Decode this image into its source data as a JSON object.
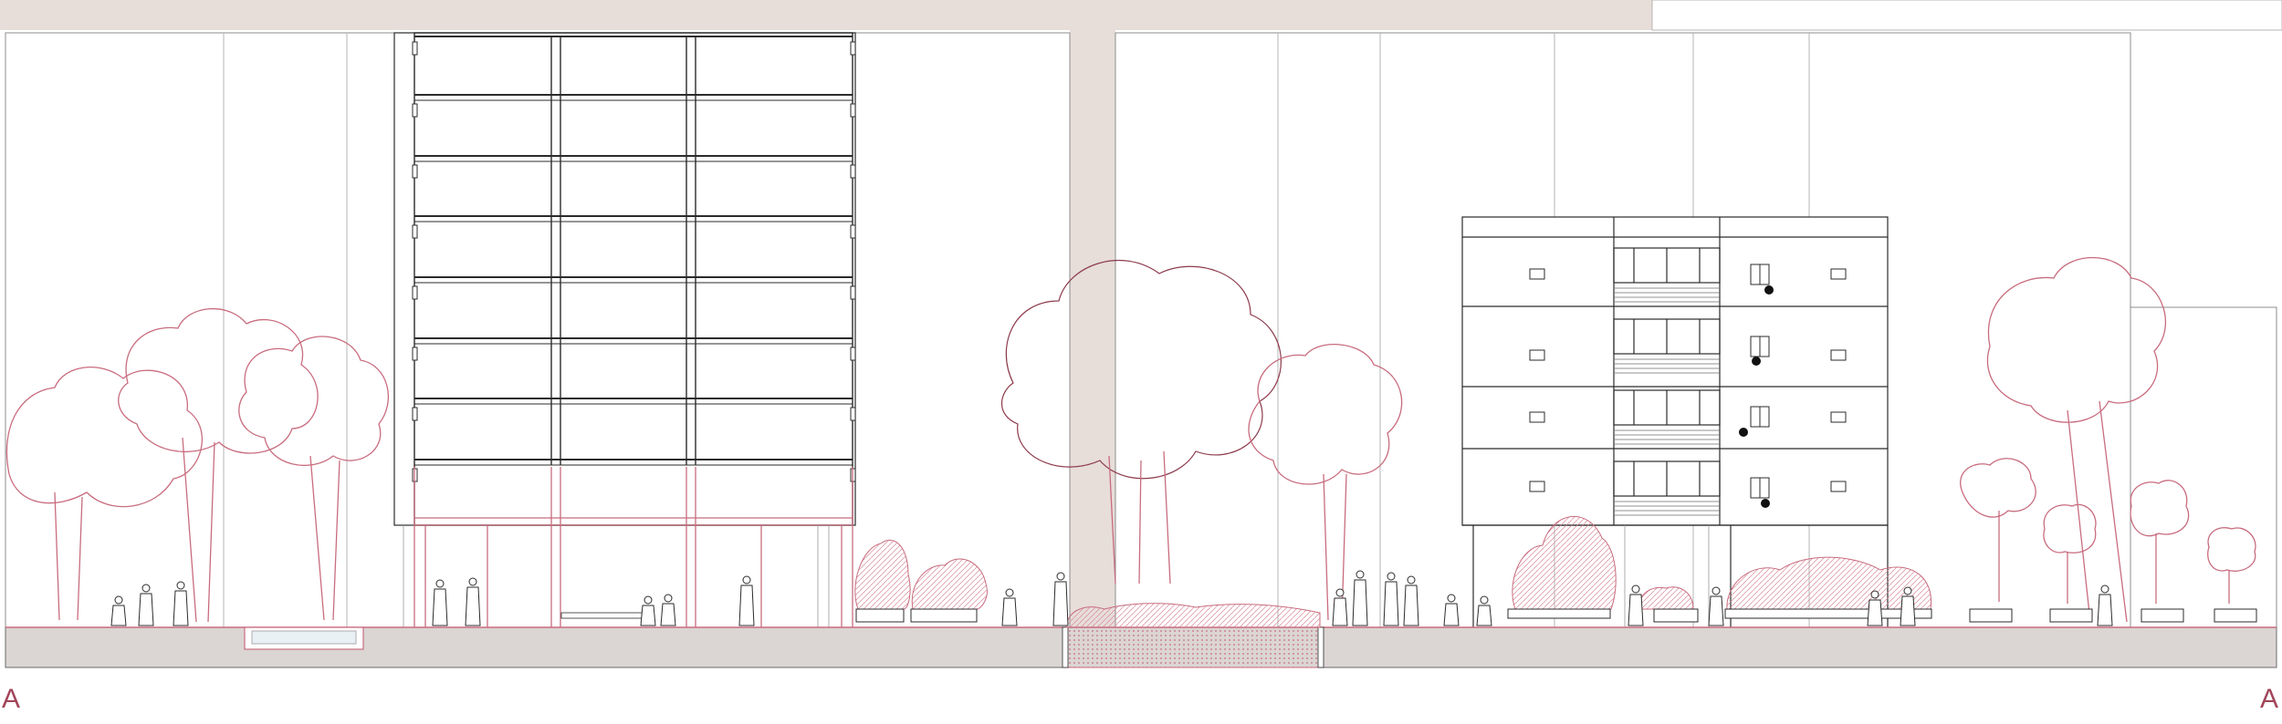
{
  "section": {
    "marker_left": "A",
    "marker_right": "A"
  },
  "colors": {
    "background": "#ffffff",
    "backdrop_band": "#e7ddd9",
    "ground_fill": "#dbd5d3",
    "line_dark": "#2b2b2b",
    "line_grey": "#9a9a9a",
    "vegetation": "#c86c7e",
    "vegetation_light": "#e3a9b6",
    "marker_text": "#a1455a"
  }
}
